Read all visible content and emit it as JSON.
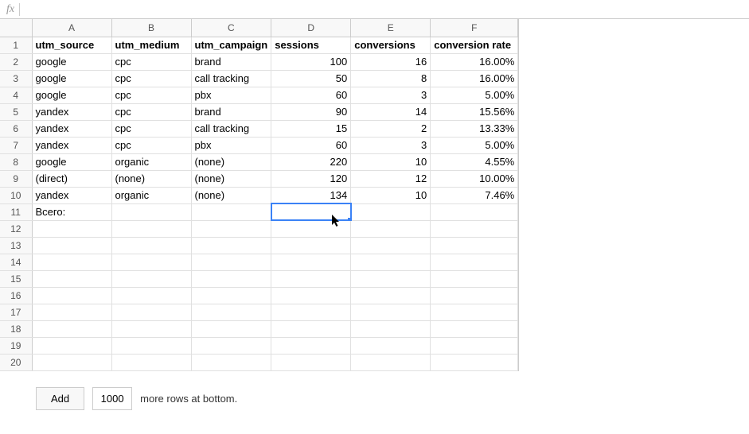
{
  "formulaBar": {
    "value": ""
  },
  "columns": [
    "A",
    "B",
    "C",
    "D",
    "E",
    "F"
  ],
  "rowCount": 20,
  "headers": {
    "A": "utm_source",
    "B": "utm_medium",
    "C": "utm_campaign",
    "D": "sessions",
    "E": "conversions",
    "F": "conversion rate"
  },
  "rows": [
    {
      "A": "google",
      "B": "cpc",
      "C": "brand",
      "D": "100",
      "E": "16",
      "F": "16.00%"
    },
    {
      "A": "google",
      "B": "cpc",
      "C": "call tracking",
      "D": "50",
      "E": "8",
      "F": "16.00%"
    },
    {
      "A": "google",
      "B": "cpc",
      "C": "pbx",
      "D": "60",
      "E": "3",
      "F": "5.00%"
    },
    {
      "A": "yandex",
      "B": "cpc",
      "C": "brand",
      "D": "90",
      "E": "14",
      "F": "15.56%"
    },
    {
      "A": "yandex",
      "B": "cpc",
      "C": "call tracking",
      "D": "15",
      "E": "2",
      "F": "13.33%"
    },
    {
      "A": "yandex",
      "B": "cpc",
      "C": "pbx",
      "D": "60",
      "E": "3",
      "F": "5.00%"
    },
    {
      "A": "google",
      "B": "organic",
      "C": "(none)",
      "D": "220",
      "E": "10",
      "F": "4.55%"
    },
    {
      "A": "(direct)",
      "B": "(none)",
      "C": "(none)",
      "D": "120",
      "E": "12",
      "F": "10.00%"
    },
    {
      "A": "yandex",
      "B": "organic",
      "C": "(none)",
      "D": "134",
      "E": "10",
      "F": "7.46%"
    },
    {
      "A": "Всего:",
      "B": "",
      "C": "",
      "D": "",
      "E": "",
      "F": ""
    }
  ],
  "selectedCell": "D11",
  "bottom": {
    "addLabel": "Add",
    "rowsValue": "1000",
    "suffix": "more rows at bottom."
  }
}
